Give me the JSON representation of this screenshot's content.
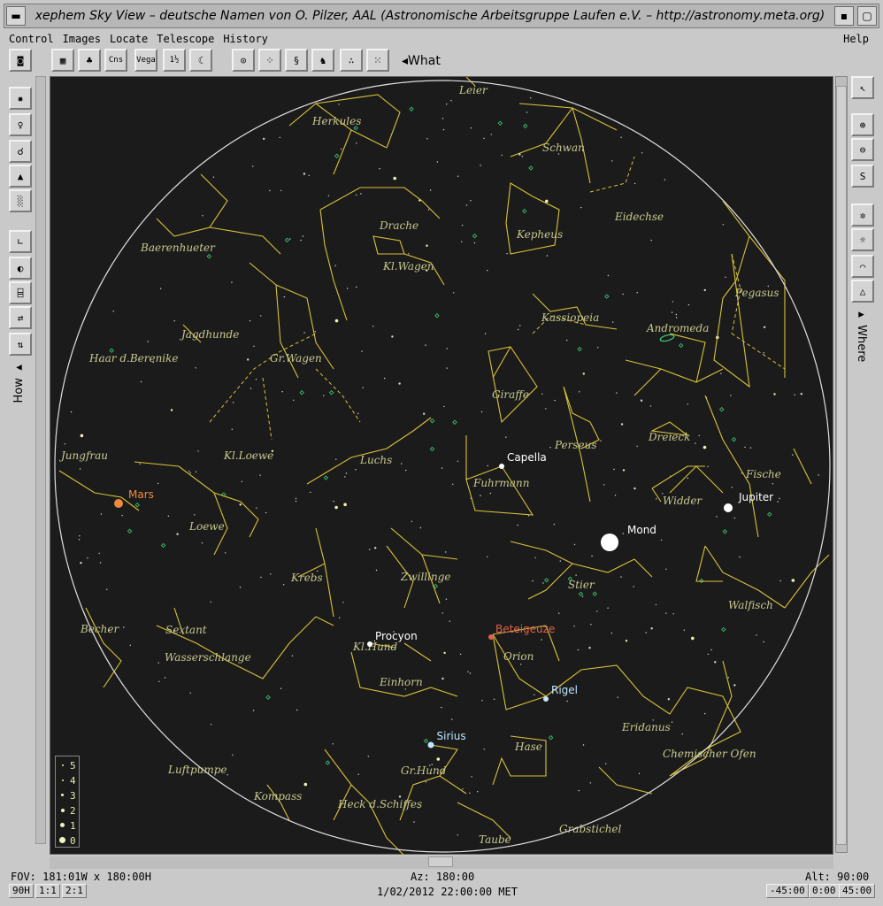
{
  "window": {
    "title": "xephem Sky View – deutsche Namen von O. Pilzer, AAL (Astronomische Arbeitsgruppe Laufen e.V. – http://astronomy.meta.org)"
  },
  "menu": {
    "items": [
      "Control",
      "Images",
      "Locate",
      "Telescope",
      "History"
    ],
    "help": "Help"
  },
  "toolbar": {
    "what": "What",
    "buttons": [
      {
        "name": "camera-icon",
        "glyph": "📷"
      },
      {
        "name": "grid-icon",
        "glyph": "▦"
      },
      {
        "name": "horizon-trees-icon",
        "glyph": "♣"
      },
      {
        "name": "constellation-lines-icon",
        "glyph": "Cns"
      },
      {
        "name": "constellation-names-icon",
        "glyph": "Vega"
      },
      {
        "name": "magnitude-label-icon",
        "glyph": "1½"
      },
      {
        "name": "moon-outline-icon",
        "glyph": "☾"
      },
      {
        "name": "telescope-marker-icon",
        "glyph": "⊙"
      },
      {
        "name": "cluster-icon",
        "glyph": "⁘"
      },
      {
        "name": "galaxy-icon",
        "glyph": "§"
      },
      {
        "name": "nebula-icon",
        "glyph": "♞"
      },
      {
        "name": "stars-icon",
        "glyph": "∴"
      },
      {
        "name": "dense-stars-icon",
        "glyph": "⁙"
      }
    ]
  },
  "left_panel": {
    "label": "How",
    "buttons": [
      "bright-star-icon",
      "lamp-icon",
      "labels-lamp-icon",
      "cone-icon",
      "blur-icon",
      "axes-icon",
      "phase-icon",
      "cylinder-icon",
      "flip-horizontal-icon",
      "flip-vertical-icon"
    ]
  },
  "right_panel": {
    "label": "Where",
    "buttons": [
      "pointer-icon",
      "zoom-in-icon",
      "zoom-out-icon",
      "save-icon",
      "gear-icon",
      "sun-icon",
      "landscape-icon",
      "pyramid-icon"
    ]
  },
  "sky": {
    "constellations": [
      {
        "name": "Leier"
      },
      {
        "name": "Herkules"
      },
      {
        "name": "Schwan"
      },
      {
        "name": "Drache"
      },
      {
        "name": "Eidechse"
      },
      {
        "name": "Kepheus"
      },
      {
        "name": "Baerenhueter"
      },
      {
        "name": "Kl.Wagen"
      },
      {
        "name": "Pegasus"
      },
      {
        "name": "Kassiopeia"
      },
      {
        "name": "Jagdhunde"
      },
      {
        "name": "Andromeda"
      },
      {
        "name": "Haar d.Berenike"
      },
      {
        "name": "Gr.Wagen"
      },
      {
        "name": "Giraffe"
      },
      {
        "name": "Dreieck"
      },
      {
        "name": "Perseus"
      },
      {
        "name": "Jungfrau"
      },
      {
        "name": "Kl.Loewe"
      },
      {
        "name": "Luchs"
      },
      {
        "name": "Fische"
      },
      {
        "name": "Fuhrmann"
      },
      {
        "name": "Widder"
      },
      {
        "name": "Loewe"
      },
      {
        "name": "Krebs"
      },
      {
        "name": "Zwillinge"
      },
      {
        "name": "Stier"
      },
      {
        "name": "Walfisch"
      },
      {
        "name": "Becher"
      },
      {
        "name": "Sextant"
      },
      {
        "name": "Kl.Hund"
      },
      {
        "name": "Orion"
      },
      {
        "name": "Wasserschlange"
      },
      {
        "name": "Einhorn"
      },
      {
        "name": "Eridanus"
      },
      {
        "name": "Hase"
      },
      {
        "name": "Chemischer Ofen"
      },
      {
        "name": "Gr.Hund"
      },
      {
        "name": "Luftpumpe"
      },
      {
        "name": "Kompass"
      },
      {
        "name": "Heck d.Schiffes"
      },
      {
        "name": "Grabstichel"
      },
      {
        "name": "Taube"
      }
    ],
    "objects": [
      {
        "name": "Mars",
        "color": "#f08a3c"
      },
      {
        "name": "Capella",
        "color": "#ffffff"
      },
      {
        "name": "Jupiter",
        "color": "#ffffff"
      },
      {
        "name": "Mond",
        "color": "#ffffff"
      },
      {
        "name": "Procyon",
        "color": "#ffffff"
      },
      {
        "name": "Beteigeuze",
        "color": "#e0604a"
      },
      {
        "name": "Rigel",
        "color": "#bfe6ff"
      },
      {
        "name": "Sirius",
        "color": "#bfe6ff"
      }
    ]
  },
  "legend": {
    "magnitudes": [
      "5",
      "4",
      "3",
      "2",
      "1",
      "0"
    ]
  },
  "status": {
    "fov": "FOV: 181:01W x 180:00H",
    "az": "Az: 180:00",
    "alt": "Alt: 90:00",
    "datetime": "1/02/2012 22:00:00 MET",
    "left_buttons": [
      "90H",
      "1:1",
      "2:1"
    ],
    "right_buttons": [
      "-45:00",
      "0:00",
      "45:00"
    ]
  },
  "colors": {
    "background": "#1b1b1b",
    "constellation_line": "#d8c23a",
    "constellation_label": "#c8c890",
    "horizon": "#e0e0e0"
  }
}
